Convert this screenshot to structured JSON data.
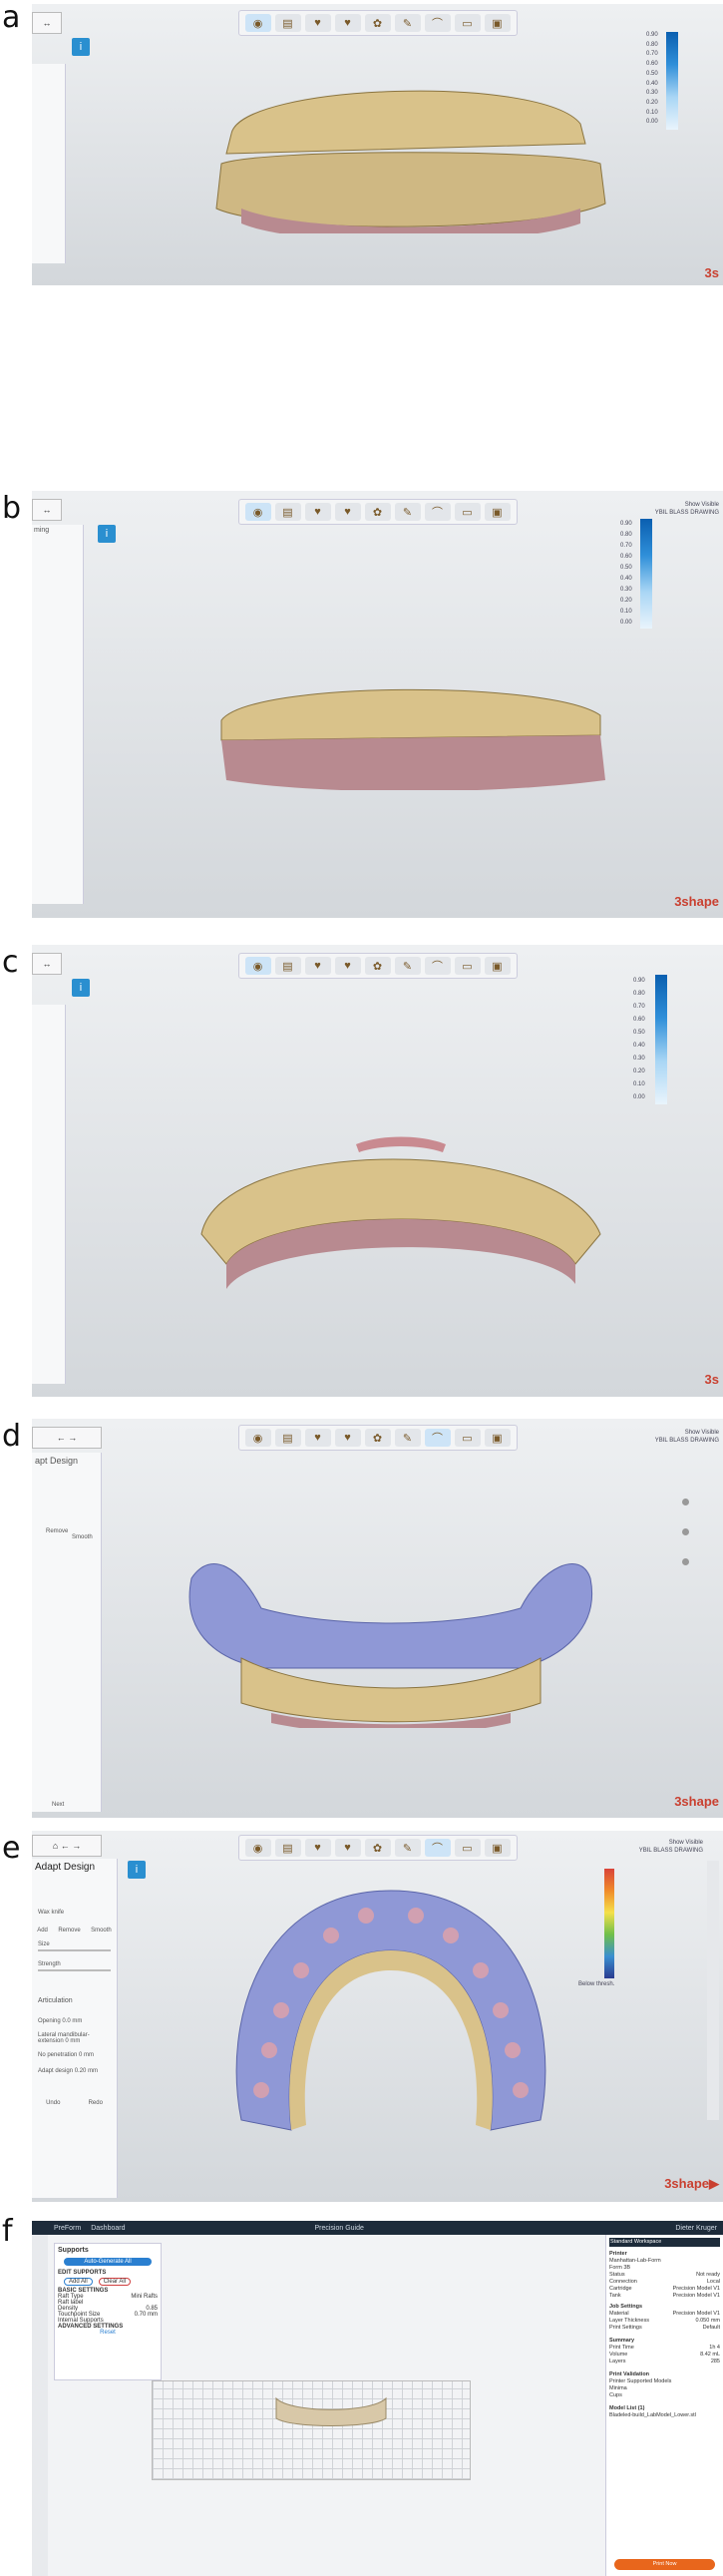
{
  "panels": [
    {
      "label": "a",
      "brand": "3s",
      "brand_accent": ""
    },
    {
      "label": "b",
      "brand": "3shape",
      "brand_accent": "",
      "left_title": "ming"
    },
    {
      "label": "c",
      "brand": "3s",
      "brand_accent": ""
    },
    {
      "label": "d",
      "brand": "3shape",
      "brand_accent": "",
      "left_title": "apt Design"
    },
    {
      "label": "e",
      "brand": "3shape",
      "brand_accent": "▶",
      "left_title": "Adapt Design"
    },
    {
      "label": "f"
    }
  ],
  "scale_ticks": [
    "0.90",
    "0.80",
    "0.70",
    "0.60",
    "0.50",
    "0.40",
    "0.30",
    "0.20",
    "0.10",
    "0.00"
  ],
  "view_labels": {
    "show_visible": "Show Visible",
    "bite_label": "YBIL BLASS DRAWING"
  },
  "panel_d": {
    "remove": "Remove",
    "smooth": "Smooth",
    "nav": "Next"
  },
  "panel_e": {
    "section": "Wax knife",
    "add": "Add",
    "remove": "Remove",
    "smooth": "Smooth",
    "size": "Size",
    "strength": "Strength",
    "articulation": "Articulation",
    "opening": "Opening",
    "opening_val": "0.0",
    "opening_unit": "mm",
    "lateral": "Lateral mandibular-extension 0 mm",
    "no_penetration": "No penetration 0 mm",
    "adapt_design": "Adapt design",
    "adapt_val": "0.20",
    "adapt_unit": "mm",
    "undo": "Undo",
    "redo": "Redo",
    "scale_low": "Below thresh."
  },
  "panel_f": {
    "top_tabs": [
      "PreForm",
      "Dashboard"
    ],
    "file_title": "Precision Guide",
    "supports_title": "Supports",
    "auto_button": "Auto-Generate All",
    "edit_supports": "EDIT SUPPORTS",
    "add": "Add All",
    "remove": "Clear All",
    "basic_settings": "BASIC SETTINGS",
    "raft_type": "Raft Type",
    "raft_type_val": "Mini Rafts",
    "raft_label": "Raft label",
    "density": "Density",
    "density_val": "0.85",
    "touchpoint": "Touchpoint Size",
    "touchpoint_val": "0.70 mm",
    "internal": "Internal Supports",
    "advanced": "ADVANCED SETTINGS",
    "reset": "Reset",
    "printer_section": "Printer",
    "printer_name": "Manhattan-Lab-Form",
    "printer_model": "Form 3B",
    "rows": [
      [
        "Status",
        "Not ready"
      ],
      [
        "Connection",
        "Local"
      ],
      [
        "Cartridge",
        "Precision Model V1"
      ],
      [
        "Tank",
        "Precision Model V1"
      ]
    ],
    "job_section": "Job Settings",
    "job_rows": [
      [
        "Material",
        "Precision Model V1"
      ],
      [
        "Layer Thickness",
        "0.050 mm"
      ],
      [
        "Print Settings",
        "Default"
      ]
    ],
    "summary": "Summary",
    "summary_rows": [
      [
        "Print Time",
        "1h 4"
      ],
      [
        "Volume",
        "8.42 mL"
      ],
      [
        "Layers",
        "285"
      ]
    ],
    "validation": "Print Validation",
    "val_rows": [
      "Printer Supported Models",
      "Minima",
      "Cups"
    ],
    "model_list": "Model List (1)",
    "model_file": "Bladeled-build_LabModel_Lower.stl",
    "print_button": "Print Now",
    "user": "Dieter Kruger",
    "workspace": "Standard Workspace"
  }
}
